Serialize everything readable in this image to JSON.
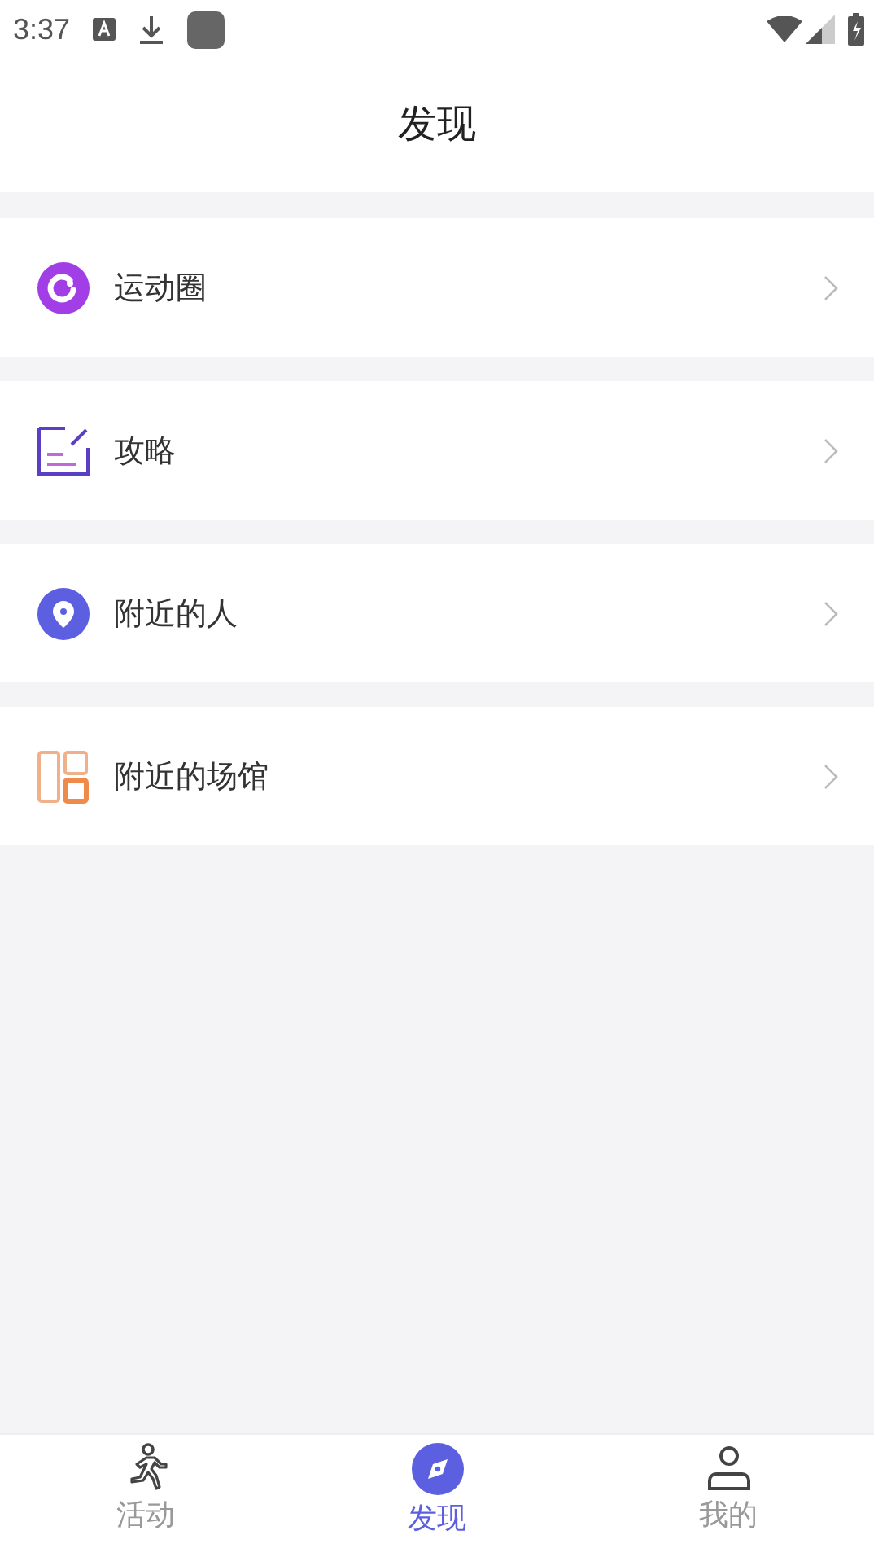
{
  "status_bar": {
    "time": "3:37"
  },
  "header": {
    "title": "发现"
  },
  "menu": [
    {
      "kind": "circle",
      "label": "运动圈"
    },
    {
      "kind": "guide",
      "label": "攻略"
    },
    {
      "kind": "nearby",
      "label": "附近的人"
    },
    {
      "kind": "venue",
      "label": "附近的场馆"
    }
  ],
  "tabs": [
    {
      "kind": "activity",
      "label": "活动",
      "selected": false
    },
    {
      "kind": "discover",
      "label": "发现",
      "selected": true
    },
    {
      "kind": "me",
      "label": "我的",
      "selected": false
    }
  ]
}
